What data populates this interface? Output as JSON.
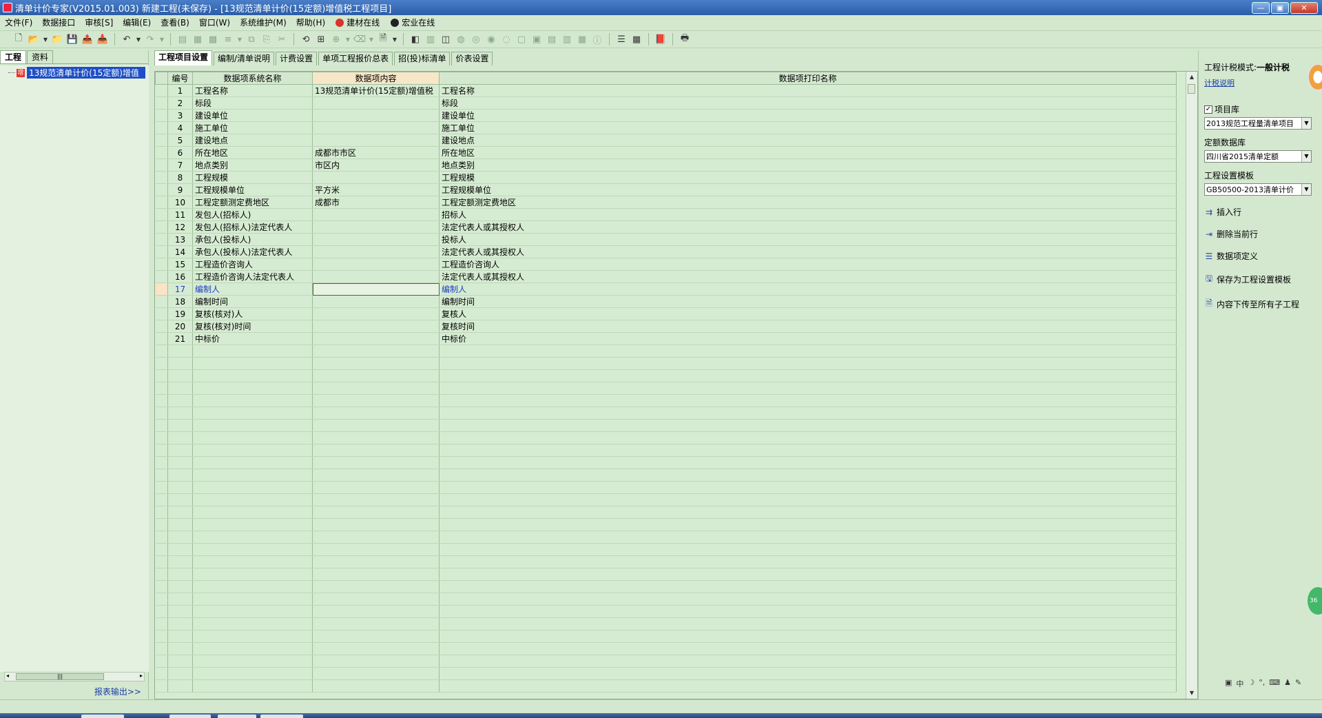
{
  "window": {
    "title": "清单计价专家(V2015.01.003) 新建工程(未保存) - [13规范清单计价(15定额)增值税工程项目]",
    "minimize": "—",
    "restore": "▣",
    "close": "✕"
  },
  "menu": {
    "items": [
      "文件(F)",
      "数据接口",
      "审核[S]",
      "编辑(E)",
      "查看(B)",
      "窗口(W)",
      "系统维护(M)",
      "帮助(H)"
    ],
    "online1": "建材在线",
    "online2": "宏业在线",
    "online1_color": "#d9342b",
    "online2_color": "#222222"
  },
  "left": {
    "tabs": [
      "工程",
      "资料"
    ],
    "tree_icon": "增",
    "tree_label": "13规范清单计价(15定额)增值",
    "report": "报表输出>>"
  },
  "main": {
    "tabs": [
      "工程项目设置",
      "编制/清单说明",
      "计费设置",
      "单项工程报价总表",
      "招(投)标清单",
      "价表设置"
    ],
    "columns": [
      "编号",
      "数据项系统名称",
      "数据项内容",
      "数据项打印名称"
    ],
    "rows": [
      {
        "no": "1",
        "name": "工程名称",
        "content": "13规范清单计价(15定额)增值税",
        "print": "工程名称"
      },
      {
        "no": "2",
        "name": "标段",
        "content": "",
        "print": "标段"
      },
      {
        "no": "3",
        "name": "建设单位",
        "content": "",
        "print": "建设单位"
      },
      {
        "no": "4",
        "name": "施工单位",
        "content": "",
        "print": "施工单位"
      },
      {
        "no": "5",
        "name": "建设地点",
        "content": "",
        "print": "建设地点"
      },
      {
        "no": "6",
        "name": "所在地区",
        "content": "成都市市区",
        "print": "所在地区"
      },
      {
        "no": "7",
        "name": "地点类别",
        "content": "市区内",
        "print": "地点类别"
      },
      {
        "no": "8",
        "name": "工程规模",
        "content": "",
        "print": "工程规模"
      },
      {
        "no": "9",
        "name": "工程规模单位",
        "content": "平方米",
        "print": "工程规模单位"
      },
      {
        "no": "10",
        "name": "工程定额测定费地区",
        "content": "成都市",
        "print": "工程定额测定费地区"
      },
      {
        "no": "11",
        "name": "发包人(招标人)",
        "content": "",
        "print": "招标人"
      },
      {
        "no": "12",
        "name": "发包人(招标人)法定代表人",
        "content": "",
        "print": "法定代表人或其授权人"
      },
      {
        "no": "13",
        "name": "承包人(投标人)",
        "content": "",
        "print": "投标人"
      },
      {
        "no": "14",
        "name": "承包人(投标人)法定代表人",
        "content": "",
        "print": "法定代表人或其授权人"
      },
      {
        "no": "15",
        "name": "工程造价咨询人",
        "content": "",
        "print": "工程造价咨询人"
      },
      {
        "no": "16",
        "name": "工程造价咨询人法定代表人",
        "content": "",
        "print": "法定代表人或其授权人"
      },
      {
        "no": "17",
        "name": "编制人",
        "content": "",
        "print": "编制人",
        "active": true
      },
      {
        "no": "18",
        "name": "编制时间",
        "content": "",
        "print": "编制时间"
      },
      {
        "no": "19",
        "name": "复核(核对)人",
        "content": "",
        "print": "复核人"
      },
      {
        "no": "20",
        "name": "复核(核对)时间",
        "content": "",
        "print": "复核时间"
      },
      {
        "no": "21",
        "name": "中标价",
        "content": "",
        "print": "中标价"
      }
    ]
  },
  "right": {
    "tax_mode_label": "工程计税模式:",
    "tax_mode_value": "一般计税",
    "tax_link": "计税说明",
    "project_lib_label": "项目库",
    "project_lib_checked": "✓",
    "project_lib_value": "2013规范工程量清单项目",
    "quota_db_label": "定额数据库",
    "quota_db_value": "四川省2015清单定额",
    "template_label": "工程设置模板",
    "template_value": "GB50500-2013清单计价",
    "actions": [
      "插入行",
      "删除当前行",
      "数据项定义",
      "保存为工程设置模板",
      "内容下传至所有子工程"
    ],
    "ime": [
      "中",
      "☽",
      "°,",
      "⌨",
      "♟",
      "✎"
    ],
    "green_bubble": "36"
  }
}
